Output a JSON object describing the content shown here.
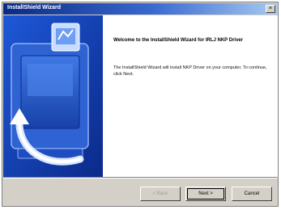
{
  "window": {
    "title": "InstallShield Wizard",
    "close_glyph": "×"
  },
  "content": {
    "welcome": "Welcome to the InstallShield Wizard for IRLJ NKP Driver",
    "body": "The InstallShield Wizard will install NKP Driver on your computer. To continue, click Next."
  },
  "buttons": {
    "back": "< Back",
    "next": "Next >",
    "cancel": "Cancel"
  },
  "icons": [
    "close-icon",
    "installer-computer-icon",
    "install-arrow-icon"
  ]
}
